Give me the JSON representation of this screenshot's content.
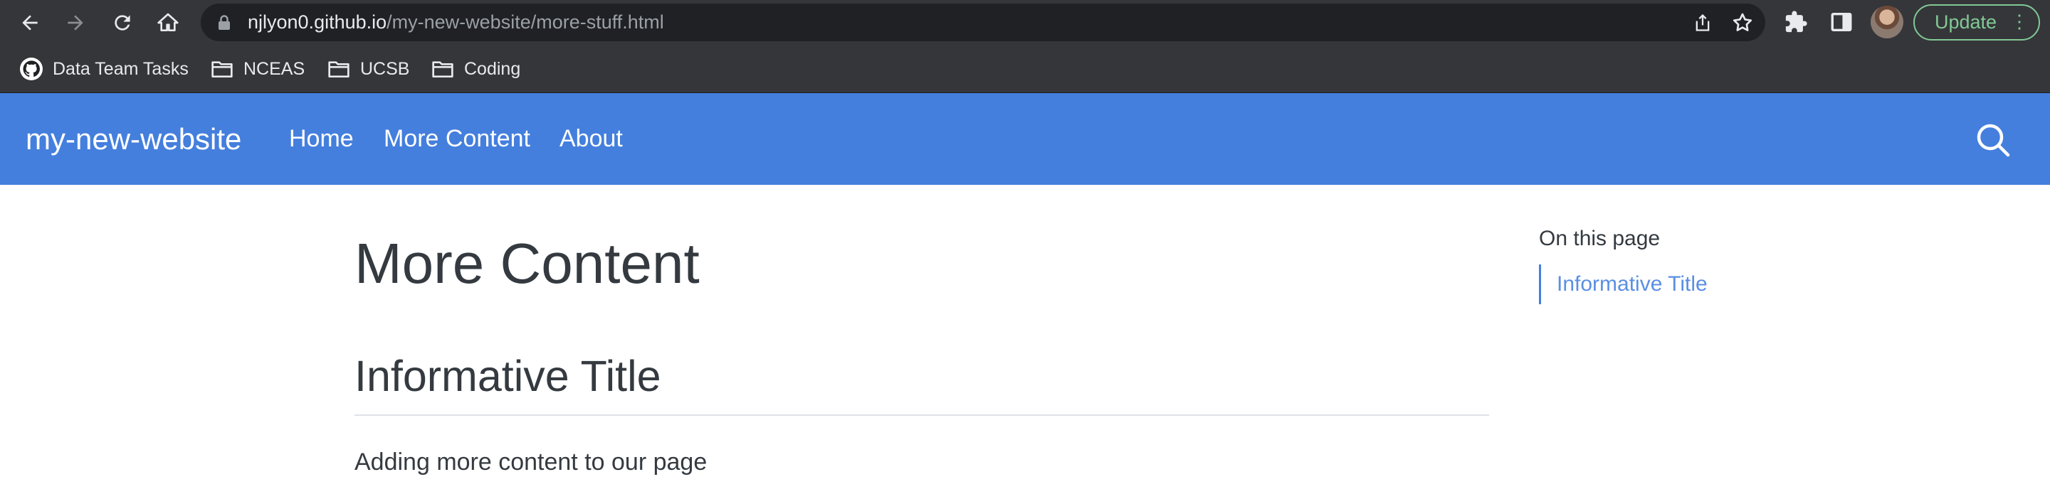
{
  "browser": {
    "url_host": "njlyon0.github.io",
    "url_path": "/my-new-website/more-stuff.html",
    "update_label": "Update",
    "menu_glyph": "⋮",
    "icons": [
      "back-icon",
      "forward-icon",
      "reload-icon",
      "home-icon",
      "lock-icon",
      "share-icon",
      "star-icon",
      "extensions-icon",
      "side-panel-icon",
      "profile-avatar",
      "kebab-menu-icon"
    ]
  },
  "bookmarks": [
    {
      "label": "Data Team Tasks",
      "icon": "github-icon"
    },
    {
      "label": "NCEAS",
      "icon": "folder-icon"
    },
    {
      "label": "UCSB",
      "icon": "folder-icon"
    },
    {
      "label": "Coding",
      "icon": "folder-icon"
    }
  ],
  "site": {
    "brand": "my-new-website",
    "nav": [
      {
        "label": "Home"
      },
      {
        "label": "More Content"
      },
      {
        "label": "About"
      }
    ],
    "search_icon": "search-icon",
    "accent_color": "#447fdd"
  },
  "content": {
    "title": "More Content",
    "section_title": "Informative Title",
    "paragraph": "Adding more content to our page"
  },
  "toc": {
    "heading": "On this page",
    "items": [
      {
        "label": "Informative Title"
      }
    ]
  }
}
